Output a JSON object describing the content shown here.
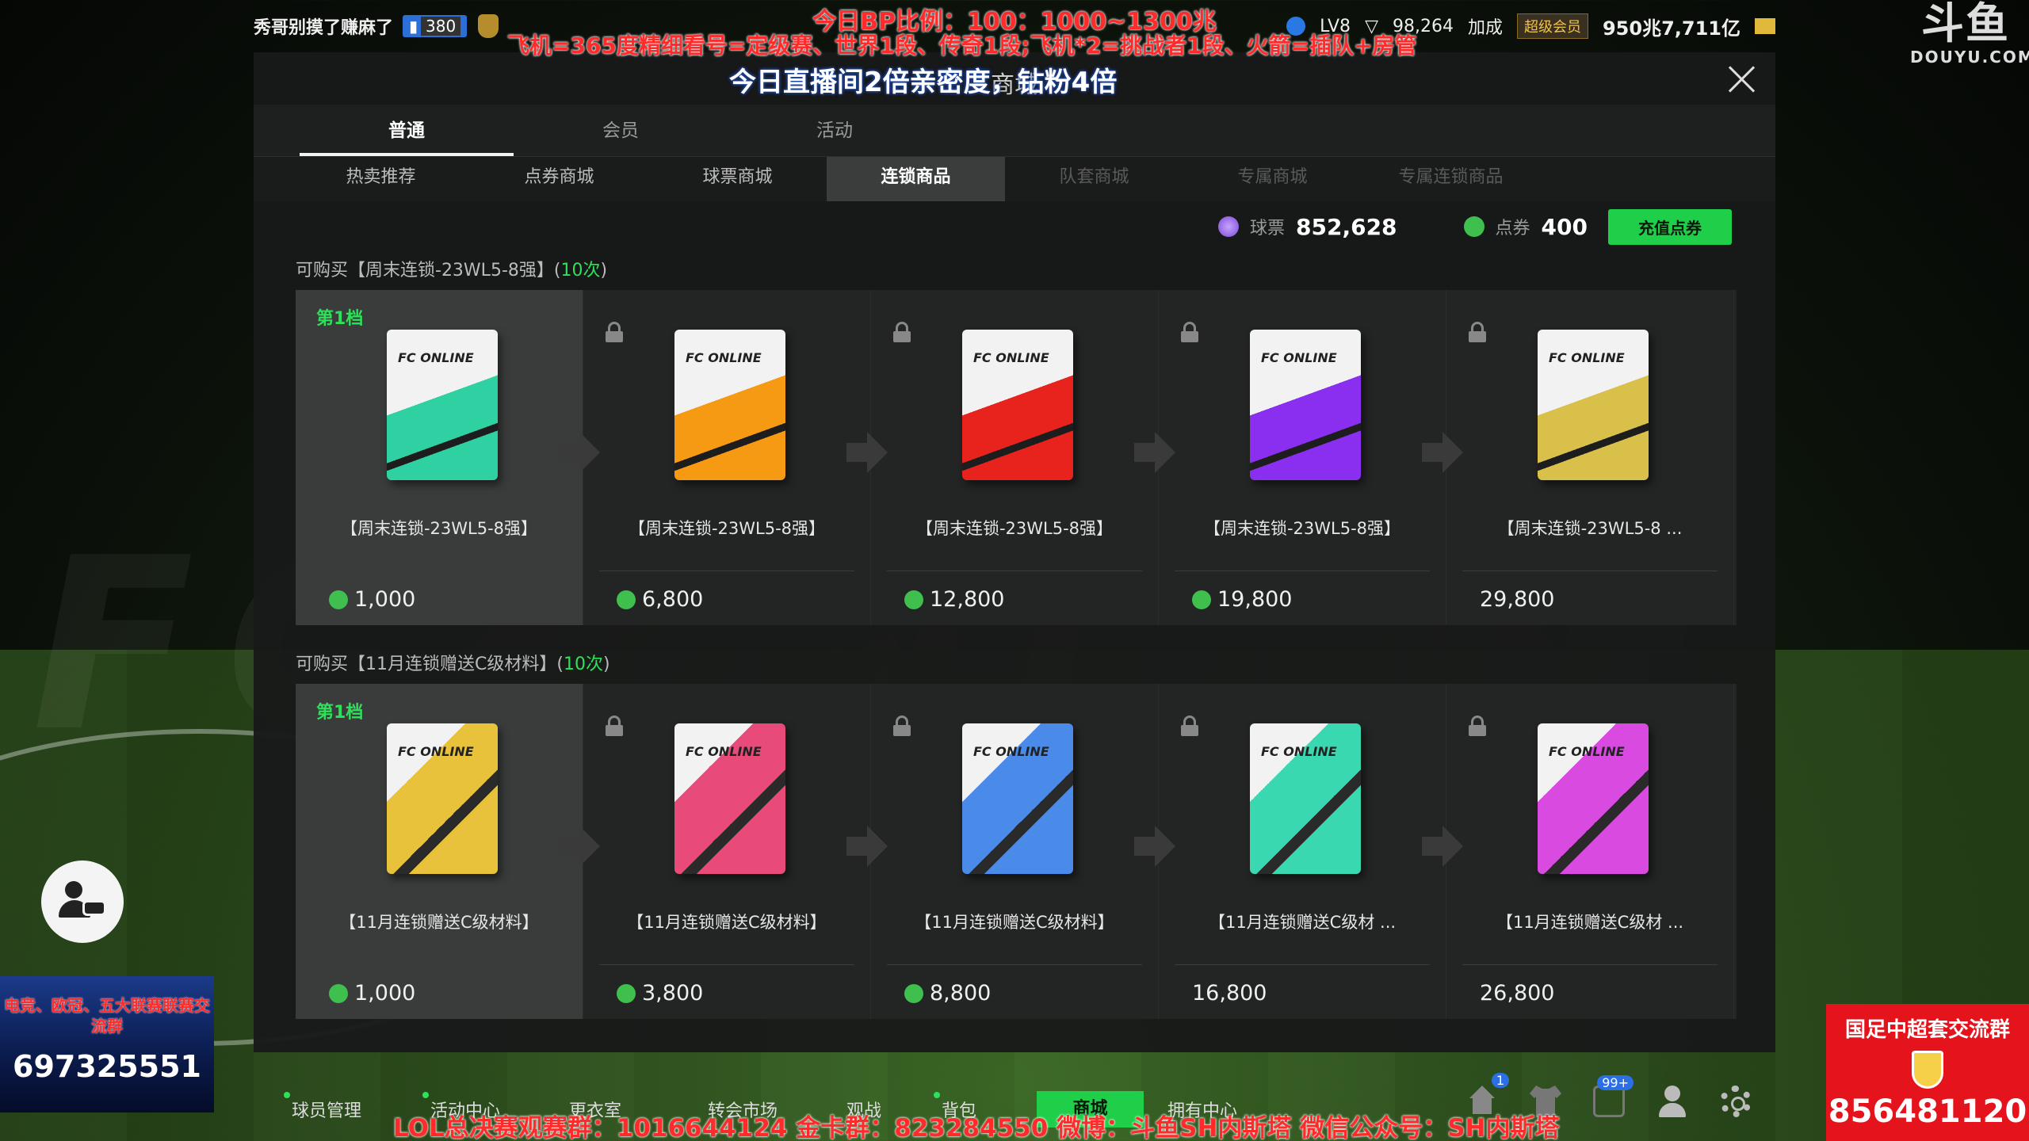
{
  "topbar": {
    "username": "秀哥别摸了赚麻了",
    "level_badge": "380",
    "right_level": "LV8",
    "right_score": "98,264",
    "boost_label": "加成",
    "vip_label": "超级会员",
    "gold_value": "950兆7,711亿"
  },
  "overlay": {
    "line1": "今日BP比例：100：1000~1300兆",
    "line2": "飞机=365度精细看号=定级赛、世界1段、传奇1段;飞机*2=挑战者1段、火箭=插队+房管",
    "line3": "今日直播间2倍亲密度，钻粉4倍",
    "bottom": "LOL总决赛观赛群：1016644124  金卡群：823284550  微博：斗鱼SH内斯塔  微信公众号：SH内斯塔"
  },
  "brand": {
    "cn": "斗鱼",
    "en": "DOUYU.COM"
  },
  "modal": {
    "title": "商城",
    "main_tabs": [
      "普通",
      "会员",
      "活动"
    ],
    "sub_tabs": [
      "热卖推荐",
      "点券商城",
      "球票商城",
      "连锁商品",
      "队套商城",
      "专属商城",
      "专属连锁商品"
    ],
    "currency": {
      "tickets_label": "球票",
      "tickets_value": "852,628",
      "points_label": "点券",
      "points_value": "400",
      "topup_label": "充值点券"
    },
    "sections": [
      {
        "title_prefix": "可购买【周末连锁-23WL5-8强】(",
        "title_count": "10次",
        "title_suffix": ")",
        "tier_label": "第1档",
        "cards": [
          {
            "name": "【周末连锁-23WL5-8强】",
            "price": "1,000",
            "coin": true
          },
          {
            "name": "【周末连锁-23WL5-8强】",
            "price": "6,800",
            "coin": true
          },
          {
            "name": "【周末连锁-23WL5-8强】",
            "price": "12,800",
            "coin": true
          },
          {
            "name": "【周末连锁-23WL5-8强】",
            "price": "19,800",
            "coin": true
          },
          {
            "name": "【周末连锁-23WL5-8 ...",
            "price": "29,800",
            "coin": false
          }
        ]
      },
      {
        "title_prefix": "可购买【11月连锁赠送C级材料】(",
        "title_count": "10次",
        "title_suffix": ")",
        "tier_label": "第1档",
        "cards": [
          {
            "name": "【11月连锁赠送C级材料】",
            "price": "1,000",
            "coin": true
          },
          {
            "name": "【11月连锁赠送C级材料】",
            "price": "3,800",
            "coin": true
          },
          {
            "name": "【11月连锁赠送C级材料】",
            "price": "8,800",
            "coin": true
          },
          {
            "name": "【11月连锁赠送C级材 ...",
            "price": "16,800",
            "coin": false
          },
          {
            "name": "【11月连锁赠送C级材 ...",
            "price": "26,800",
            "coin": false
          }
        ]
      }
    ],
    "pack_brand": "FC ONLINE",
    "pack_colors_row1": [
      "#2fd1a2",
      "#f59a12",
      "#e8231e",
      "#8a2ff0",
      "#d8c04a"
    ],
    "pack_colors_row2": [
      "#e8c23a",
      "#e84a7a",
      "#4a8ae8",
      "#3ad8b0",
      "#d84ae0"
    ]
  },
  "bottom_nav": {
    "items": [
      "球员管理",
      "活动中心",
      "更衣室",
      "转会市场",
      "观战",
      "背包",
      "商城",
      "拥有中心"
    ],
    "active_index": 6,
    "badge_home": "1",
    "badge_locker": "99+"
  },
  "promo_left": {
    "title": "电竞、欧冠、五大联赛联赛交流群",
    "number": "697325551"
  },
  "promo_right": {
    "title": "国足中超套交流群",
    "number": "856481120"
  }
}
